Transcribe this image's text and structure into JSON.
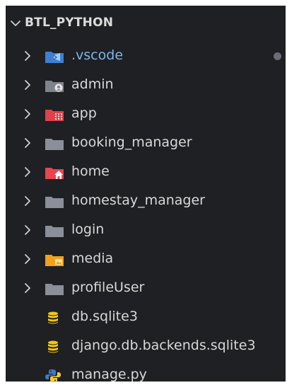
{
  "explorer": {
    "root_label": "BTL_PYTHON",
    "items": [
      {
        "label": "vscode-prefix",
        "text": ".vscode",
        "type": "folder",
        "icon": "vscode-folder-icon",
        "color": "#3f7fd0",
        "modified_dot": true
      },
      {
        "text": "admin",
        "type": "folder",
        "icon": "admin-folder-icon",
        "color": "#8a8f99"
      },
      {
        "text": "app",
        "type": "folder",
        "icon": "app-folder-icon",
        "color": "#e0424b"
      },
      {
        "text": "booking_manager",
        "type": "folder",
        "icon": "folder-icon",
        "color": "#8a8f99"
      },
      {
        "text": "home",
        "type": "folder",
        "icon": "home-folder-icon",
        "color": "#e9454e"
      },
      {
        "text": "homestay_manager",
        "type": "folder",
        "icon": "folder-icon",
        "color": "#8a8f99"
      },
      {
        "text": "login",
        "type": "folder",
        "icon": "folder-icon",
        "color": "#8a8f99"
      },
      {
        "text": "media",
        "type": "folder",
        "icon": "media-folder-icon",
        "color": "#f2a11a"
      },
      {
        "text": "profileUser",
        "type": "folder",
        "icon": "folder-icon",
        "color": "#8a8f99"
      },
      {
        "text": "db.sqlite3",
        "type": "file",
        "icon": "database-icon",
        "color": "#f5c518"
      },
      {
        "text": "django.db.backends.sqlite3",
        "type": "file",
        "icon": "database-icon",
        "color": "#f5c518"
      },
      {
        "text": "manage.py",
        "type": "file",
        "icon": "python-icon",
        "color": "#3e7cc1"
      }
    ]
  }
}
